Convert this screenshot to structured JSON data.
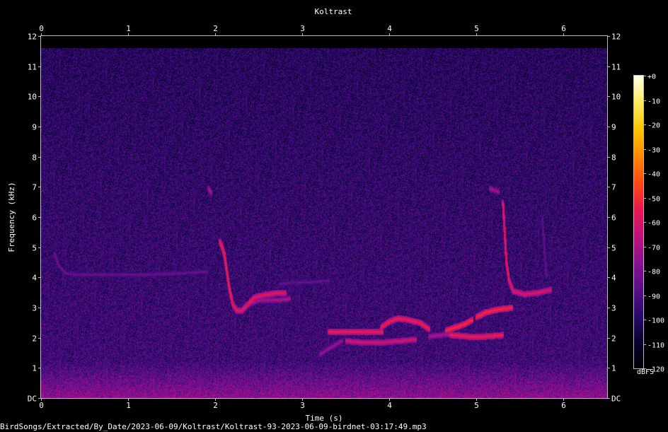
{
  "chart_data": {
    "type": "heatmap",
    "title": "Koltrast",
    "xlabel": "Time (s)",
    "ylabel": "Frequency (kHz)",
    "xlim": [
      0,
      6.5
    ],
    "ylim": [
      0,
      12
    ],
    "x_ticks": [
      "0",
      "1",
      "2",
      "3",
      "4",
      "5",
      "6"
    ],
    "x_tick_values": [
      0,
      1,
      2,
      3,
      4,
      5,
      6
    ],
    "y_ticks": [
      "DC",
      "1",
      "2",
      "3",
      "4",
      "5",
      "6",
      "7",
      "8",
      "9",
      "10",
      "11",
      "12"
    ],
    "y_tick_values": [
      0,
      1,
      2,
      3,
      4,
      5,
      6,
      7,
      8,
      9,
      10,
      11,
      12
    ],
    "noise_ceiling_khz": 11.6,
    "colorbar": {
      "label": "dBFS",
      "ticks": [
        "+0",
        "-10",
        "-20",
        "-30",
        "-40",
        "-50",
        "-60",
        "-70",
        "-80",
        "-90",
        "-100",
        "-110",
        "-120"
      ],
      "tick_values": [
        0,
        -10,
        -20,
        -30,
        -40,
        -50,
        -60,
        -70,
        -80,
        -90,
        -100,
        -110,
        -120
      ],
      "range": [
        -120,
        0
      ],
      "colormap": [
        "#000000",
        "#0b0230",
        "#2a0a6e",
        "#5a0f88",
        "#8c1190",
        "#c0127a",
        "#e81a4c",
        "#ff4a14",
        "#ff8c00",
        "#ffc400",
        "#ffee60",
        "#ffffe8"
      ]
    },
    "song_traces": [
      {
        "t": [
          0.15,
          0.2,
          0.28,
          0.4,
          0.7,
          1.2,
          1.6,
          1.9
        ],
        "f": [
          4.8,
          4.4,
          4.15,
          4.1,
          4.1,
          4.1,
          4.15,
          4.2
        ],
        "db": -85
      },
      {
        "t": [
          1.92,
          1.95
        ],
        "f": [
          6.95,
          6.8
        ],
        "db": -72
      },
      {
        "t": [
          2.05,
          2.1,
          2.13,
          2.16,
          2.2,
          2.25,
          2.3,
          2.35,
          2.45,
          2.6,
          2.72,
          2.8
        ],
        "f": [
          5.2,
          4.8,
          4.2,
          3.6,
          3.1,
          2.9,
          2.9,
          3.05,
          3.35,
          3.45,
          3.5,
          3.5
        ],
        "db": -58
      },
      {
        "t": [
          2.35,
          2.5,
          2.7,
          2.85
        ],
        "f": [
          3.1,
          3.25,
          3.25,
          3.3
        ],
        "db": -70
      },
      {
        "t": [
          2.75,
          2.95,
          3.1,
          3.3
        ],
        "f": [
          3.8,
          3.85,
          3.85,
          3.9
        ],
        "db": -85
      },
      {
        "t": [
          3.2,
          3.3,
          3.45
        ],
        "f": [
          1.45,
          1.65,
          1.9
        ],
        "db": -75
      },
      {
        "t": [
          3.3,
          3.45,
          3.6,
          3.8,
          3.92
        ],
        "f": [
          2.2,
          2.2,
          2.2,
          2.2,
          2.2
        ],
        "db": -55
      },
      {
        "t": [
          3.5,
          3.7,
          3.9,
          4.1,
          4.3
        ],
        "f": [
          1.9,
          1.85,
          1.85,
          1.9,
          1.95
        ],
        "db": -62
      },
      {
        "t": [
          3.9,
          4.0,
          4.1,
          4.22,
          4.35,
          4.45
        ],
        "f": [
          2.35,
          2.55,
          2.65,
          2.6,
          2.5,
          2.3
        ],
        "db": -55
      },
      {
        "t": [
          4.45,
          4.6,
          4.8
        ],
        "f": [
          2.05,
          2.1,
          2.1
        ],
        "db": -70
      },
      {
        "t": [
          4.65,
          4.75,
          4.85,
          4.95
        ],
        "f": [
          2.25,
          2.35,
          2.45,
          2.6
        ],
        "db": -52
      },
      {
        "t": [
          4.7,
          4.9,
          5.1,
          5.3
        ],
        "f": [
          2.1,
          2.05,
          2.05,
          2.1
        ],
        "db": -55
      },
      {
        "t": [
          5.0,
          5.1,
          5.25,
          5.4
        ],
        "f": [
          2.7,
          2.85,
          2.95,
          3.0
        ],
        "db": -52
      },
      {
        "t": [
          5.15,
          5.25
        ],
        "f": [
          6.95,
          6.85
        ],
        "db": -72
      },
      {
        "t": [
          5.3,
          5.32,
          5.34,
          5.37,
          5.42,
          5.55,
          5.7,
          5.85
        ],
        "f": [
          6.5,
          5.5,
          4.5,
          3.9,
          3.55,
          3.45,
          3.5,
          3.6
        ],
        "db": -60
      },
      {
        "t": [
          5.75,
          5.8
        ],
        "f": [
          6.0,
          4.0
        ],
        "db": -88
      }
    ]
  },
  "footer": {
    "path": "BirdSongs/Extracted/By_Date/2023-06-09/Koltrast/Koltrast-93-2023-06-09-birdnet-03:17:49.mp3"
  }
}
